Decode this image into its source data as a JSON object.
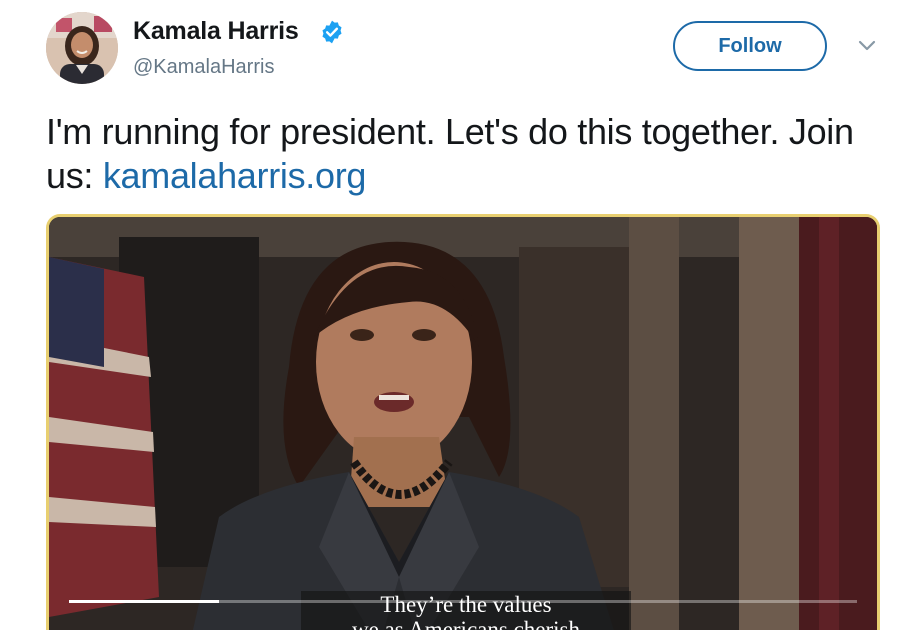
{
  "author": {
    "display_name": "Kamala Harris",
    "handle": "@KamalaHarris",
    "verified": true
  },
  "header": {
    "follow_label": "Follow"
  },
  "tweet": {
    "text_before_link": "I'm running for president. Let's do this together. Join us: ",
    "link_text": "kamalaharris.org"
  },
  "video": {
    "caption_line1": "They’re the values",
    "caption_line2": "we as Americans cherish",
    "progress_fraction": 0.19
  },
  "colors": {
    "link": "#1d6aa8",
    "verified": "#1da1f2",
    "media_border": "#e8cf70"
  },
  "icons": {
    "verified": "verified-badge-icon",
    "menu": "chevron-down-icon"
  }
}
